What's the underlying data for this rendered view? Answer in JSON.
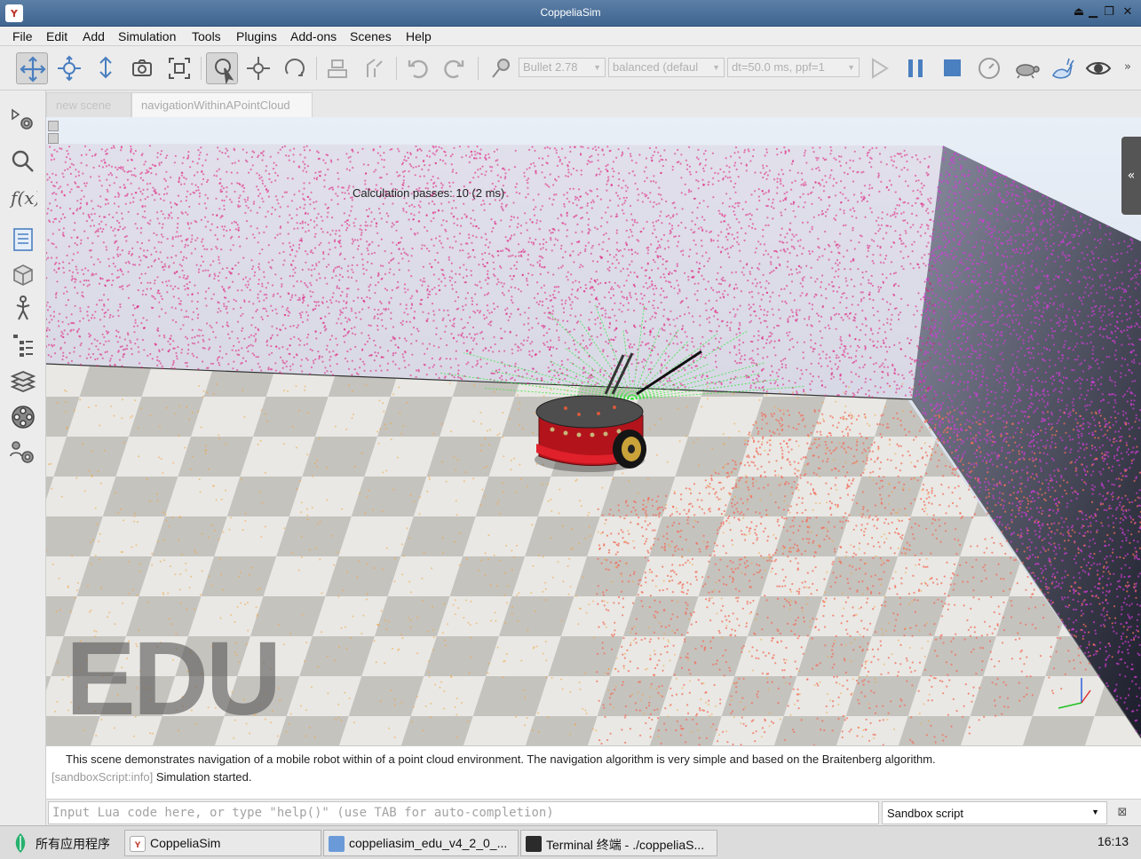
{
  "window": {
    "title": "CoppeliaSim"
  },
  "menu": [
    "File",
    "Edit",
    "Add",
    "Simulation",
    "Tools",
    "Plugins",
    "Add-ons",
    "Scenes",
    "Help"
  ],
  "toolbar": {
    "engine": "Bullet 2.78",
    "accuracy": "balanced (defaul",
    "timestep": "dt=50.0 ms, ppf=1"
  },
  "tabs": [
    {
      "label": "new scene",
      "active": false
    },
    {
      "label": "navigationWithinAPointCloud",
      "active": true
    }
  ],
  "scene": {
    "calc_text": "Calculation passes: 10 (2 ms)",
    "watermark": "EDU"
  },
  "console": {
    "line1": "This scene demonstrates navigation of a mobile robot within of a point cloud environment. The navigation algorithm is very simple and based on the Braitenberg algorithm.",
    "line2_tag": "[sandboxScript:info]",
    "line2_msg": "Simulation started."
  },
  "input": {
    "placeholder": "Input Lua code here, or type \"help()\" (use TAB for auto-completion)",
    "script_select": "Sandbox script"
  },
  "taskbar": {
    "start_label": "所有应用程序",
    "items": [
      "CoppeliaSim",
      "coppeliasim_edu_v4_2_0_...",
      "Terminal 终端 - ./coppeliaS..."
    ],
    "clock": "16:13"
  },
  "colors": {
    "wall_points": "#e0187a",
    "wall_side_points": "#d33cd9",
    "floor_points": "#f26d5b",
    "orange_points": "#f3a23a",
    "sensor_rays": "#35e33a",
    "robot_body": "#b3141c"
  }
}
